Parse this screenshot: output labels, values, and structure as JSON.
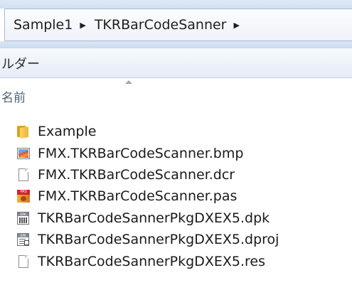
{
  "breadcrumb": {
    "items": [
      "Sample1",
      "TKRBarCodeSanner"
    ]
  },
  "toolbar": {
    "folder_label": "ルダー"
  },
  "columns": {
    "name_header": "名前"
  },
  "files": [
    {
      "name": "Example",
      "icon": "folder-icon"
    },
    {
      "name": "FMX.TKRBarCodeScanner.bmp",
      "icon": "image-file-icon"
    },
    {
      "name": "FMX.TKRBarCodeScanner.dcr",
      "icon": "blank-file-icon"
    },
    {
      "name": "FMX.TKRBarCodeScanner.pas",
      "icon": "pas-file-icon"
    },
    {
      "name": "TKRBarCodeSannerPkgDXEX5.dpk",
      "icon": "dpk-file-icon"
    },
    {
      "name": "TKRBarCodeSannerPkgDXEX5.dproj",
      "icon": "dproj-file-icon"
    },
    {
      "name": "TKRBarCodeSannerPkgDXEX5.res",
      "icon": "blank-file-icon"
    }
  ],
  "colors": {
    "header_text": "#4c607a",
    "border": "#a9bcd6"
  }
}
